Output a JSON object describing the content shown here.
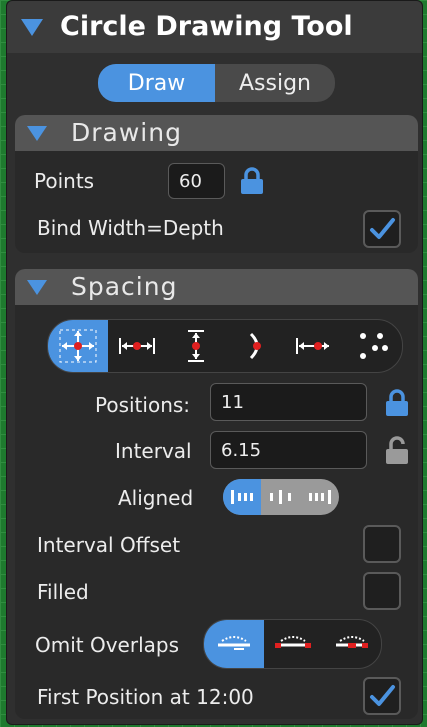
{
  "header": {
    "title": "Circle Drawing Tool"
  },
  "mode_tabs": [
    {
      "label": "Draw"
    },
    {
      "label": "Assign"
    }
  ],
  "drawing": {
    "title": "Drawing",
    "points_label": "Points",
    "points_value": "60",
    "bind_label": "Bind Width=Depth",
    "bind_checked": true
  },
  "spacing": {
    "title": "Spacing",
    "spacing_modes": [
      "fit-both-icon",
      "fit-width-icon",
      "fit-height-icon",
      "arc-icon",
      "fixed-width-icon",
      "points-icon"
    ],
    "positions_label": "Positions:",
    "positions_value": "11",
    "positions_locked": true,
    "interval_label": "Interval",
    "interval_value": "6.15",
    "interval_locked": false,
    "aligned_label": "Aligned",
    "interval_offset_label": "Interval Offset",
    "filled_label": "Filled",
    "omit_label": "Omit Overlaps",
    "first_label": "First Position at 12:00",
    "first_checked": true
  },
  "colors": {
    "accent": "#4b93e0",
    "panel": "#2f2f2f",
    "section": "#292929",
    "red": "#e02020"
  }
}
